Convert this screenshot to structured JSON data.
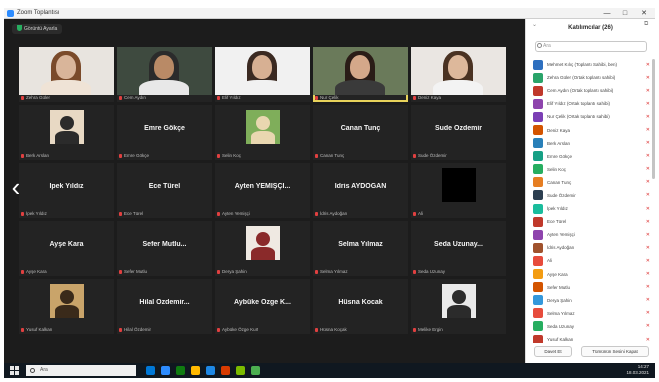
{
  "window": {
    "title": "Zoom Toplantısı",
    "controls": [
      "—",
      "□",
      "✕"
    ]
  },
  "video": {
    "top_chip": "Görüntü Ayarla",
    "tiles": [
      {
        "kind": "camera",
        "label": "Zehra Güler",
        "skin": "#d9b59a",
        "hair": "#7a4a2a",
        "shirt": "#efe3d6",
        "bg": "#e8e4df"
      },
      {
        "kind": "camera",
        "label": "Cem Aydın",
        "skin": "#b98a66",
        "hair": "#2b2b2b",
        "shirt": "#e8e8e8",
        "bg": "#3e4a3f"
      },
      {
        "kind": "camera",
        "label": "Elif Yıldız",
        "skin": "#d7b093",
        "hair": "#3b2a22",
        "shirt": "#f1f1f1",
        "bg": "#f1f1f1"
      },
      {
        "kind": "camera",
        "label": "Nur Çelik",
        "skin": "#d4a88a",
        "hair": "#2a1c17",
        "shirt": "#3a3a3a",
        "bg": "#6a7a5a",
        "speaking": true
      },
      {
        "kind": "camera",
        "label": "Deniz Kaya",
        "skin": "#ddb89b",
        "hair": "#4a3222",
        "shirt": "#f3f3f3",
        "bg": "#eae6e2"
      },
      {
        "kind": "photo",
        "label": "Berk Arslan",
        "thumb_bg": "#e8d9c4",
        "thumb_fg": "#2b2b2b"
      },
      {
        "kind": "name",
        "name": "Emre Gökçe",
        "label": "Emre Gökçe"
      },
      {
        "kind": "photo",
        "label": "Selin Koç",
        "thumb_bg": "#7fae5a",
        "thumb_fg": "#e9d7b0"
      },
      {
        "kind": "name",
        "name": "Canan Tunç",
        "label": "Canan Tunç"
      },
      {
        "kind": "name",
        "name": "Sude Özdemir",
        "label": "Sude Özdemir"
      },
      {
        "kind": "name",
        "name": "İpek Yıldız",
        "label": "İpek Yıldız"
      },
      {
        "kind": "name",
        "name": "Ece Türel",
        "label": "Ece Türel"
      },
      {
        "kind": "name",
        "name": "Ayten YEMİŞÇİ...",
        "label": "Ayten Yemişçi"
      },
      {
        "kind": "name",
        "name": "İdris AYDOĞAN",
        "label": "İdris Aydoğan"
      },
      {
        "kind": "black",
        "label": "Ali"
      },
      {
        "kind": "name",
        "name": "Ayşe Kara",
        "label": "Ayşe Kara"
      },
      {
        "kind": "name",
        "name": "Sefer Mutlu...",
        "label": "Sefer Mutlu"
      },
      {
        "kind": "photo",
        "label": "Derya Şahin",
        "thumb_bg": "#efe9e2",
        "thumb_fg": "#8a2a2a"
      },
      {
        "kind": "name",
        "name": "Selma Yılmaz",
        "label": "Selma Yılmaz"
      },
      {
        "kind": "name",
        "name": "Seda Uzunay...",
        "label": "Seda Uzunay"
      },
      {
        "kind": "photo",
        "label": "Yusuf Kalkan",
        "thumb_bg": "#c9a46a",
        "thumb_fg": "#3a2a1a"
      },
      {
        "kind": "name",
        "name": "Hilal Özdemir...",
        "label": "Hilal Özdemir"
      },
      {
        "kind": "name",
        "name": "Aybüke Özge K...",
        "label": "Aybüke Özge Kurt"
      },
      {
        "kind": "name",
        "name": "Hüsna Kocak",
        "label": "Hüsna Koçak"
      },
      {
        "kind": "photo",
        "label": "Melike Ergin",
        "thumb_bg": "#e9e9e9",
        "thumb_fg": "#2b2b2b"
      }
    ]
  },
  "panel": {
    "title": "Katılımcılar (26)",
    "search_placeholder": "Ara",
    "participants": [
      {
        "name": "Mehmet Kılıç (Toplantı Sahibi, ben)",
        "color": "#2d6fbf",
        "status": "🎤"
      },
      {
        "name": "Zehra Güler (Ortak toplantı sahibi)",
        "color": "#2aa46a",
        "status": "🎤"
      },
      {
        "name": "Cem Aydın (Ortak toplantı sahibi)",
        "color": "#c0392b",
        "status": "🎤"
      },
      {
        "name": "Elif Yıldız (Ortak toplantı sahibi)",
        "color": "#8e44ad",
        "status": "🎤"
      },
      {
        "name": "Nur Çelik (Ortak toplantı sahibi)",
        "color": "#7b3fb5",
        "status": "🎤"
      },
      {
        "name": "Deniz Kaya",
        "color": "#d35400",
        "status": "🎤"
      },
      {
        "name": "Berk Arslan",
        "color": "#2980b9",
        "status": "🎤"
      },
      {
        "name": "Emre Gökçe",
        "color": "#16a085",
        "status": "🎤"
      },
      {
        "name": "Selin Koç",
        "color": "#27ae60",
        "status": "🎤"
      },
      {
        "name": "Canan Tunç",
        "color": "#e67e22",
        "status": "🎤"
      },
      {
        "name": "Sude Özdemir",
        "color": "#2c3e50",
        "status": "🎤"
      },
      {
        "name": "İpek Yıldız",
        "color": "#1abc9c",
        "status": "🎤"
      },
      {
        "name": "Ece Türel",
        "color": "#c0392b",
        "status": "🎤"
      },
      {
        "name": "Ayten Yemişçi",
        "color": "#8e44ad",
        "status": "🎤"
      },
      {
        "name": "İdris Aydoğan",
        "color": "#a0522d",
        "status": "🎤"
      },
      {
        "name": "Ali",
        "color": "#e74c3c",
        "status": "🎤"
      },
      {
        "name": "Ayşe Kara",
        "color": "#f39c12",
        "status": "🎤"
      },
      {
        "name": "Sefer Mutlu",
        "color": "#d35400",
        "status": "🎤"
      },
      {
        "name": "Derya Şahin",
        "color": "#3498db",
        "status": "🎤"
      },
      {
        "name": "Selma Yılmaz",
        "color": "#e74c3c",
        "status": "🎤"
      },
      {
        "name": "Seda Uzunay",
        "color": "#27ae60",
        "status": "🎤"
      },
      {
        "name": "Yusuf Kalkan",
        "color": "#c0392b",
        "status": "🎤"
      }
    ],
    "invite_label": "Davet Et",
    "mute_all_label": "Tümünün Sesini Kapat"
  },
  "taskbar": {
    "search_placeholder": "Ara",
    "time": "14:27",
    "date": "18.03.2021",
    "app_colors": [
      "#0078d7",
      "#2d8cff",
      "#107c10",
      "#ffb900",
      "#1e88e5",
      "#d83b01",
      "#7cbb00",
      "#4caf50"
    ]
  }
}
